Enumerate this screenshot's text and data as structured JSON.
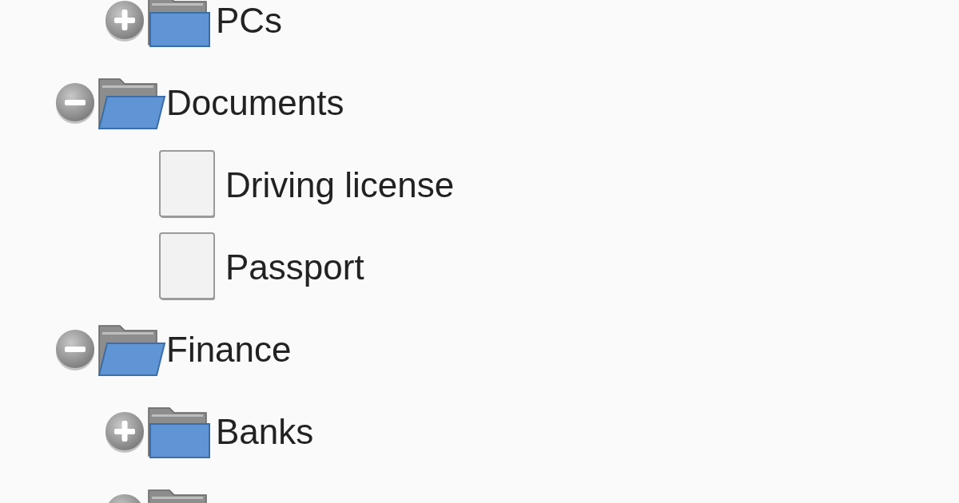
{
  "tree": {
    "items": [
      {
        "children": [
          {
            "label": "PCs",
            "kind": "folder",
            "expanded": false
          }
        ]
      },
      {
        "label": "Documents",
        "kind": "folder",
        "expanded": true,
        "children": [
          {
            "label": "Driving license",
            "kind": "file"
          },
          {
            "label": "Passport",
            "kind": "file"
          }
        ]
      },
      {
        "label": "Finance",
        "kind": "folder",
        "expanded": true,
        "children": [
          {
            "label": "Banks",
            "kind": "folder",
            "expanded": false
          },
          {
            "kind": "folder"
          }
        ]
      }
    ]
  }
}
